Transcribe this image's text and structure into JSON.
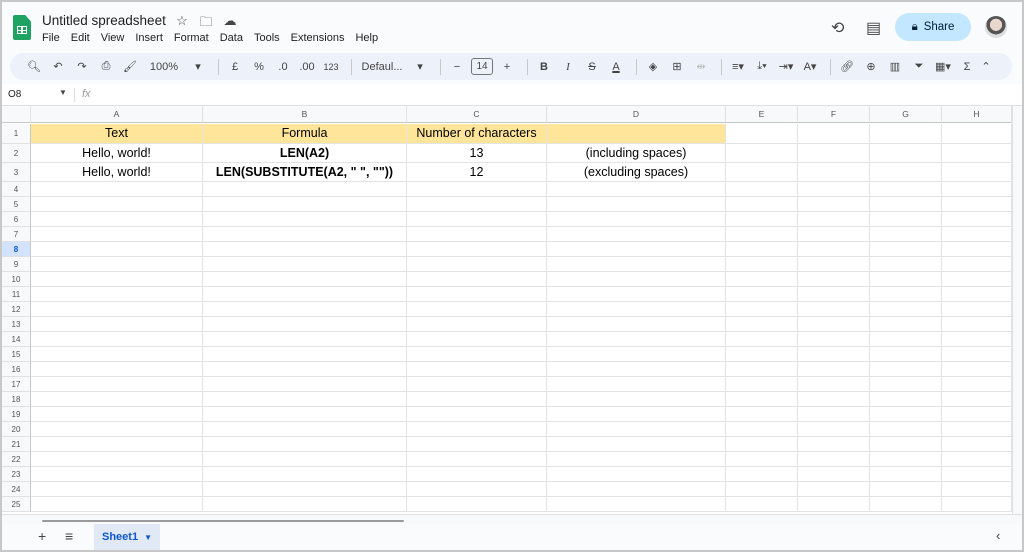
{
  "app": {
    "title": "Untitled spreadsheet",
    "accent": "#1ea362"
  },
  "title_icons": [
    "star-icon",
    "move-to-folder-icon",
    "cloud-saved-icon"
  ],
  "menu": [
    "File",
    "Edit",
    "View",
    "Insert",
    "Format",
    "Data",
    "Tools",
    "Extensions",
    "Help"
  ],
  "header": {
    "share_label": "Share"
  },
  "toolbar": {
    "zoom": "100%",
    "currency": "£",
    "percent": "%",
    "dec_decrease": ".0",
    "dec_increase": ".00",
    "number_format": "123",
    "font": "Defaul...",
    "font_size": "14",
    "minus": "−",
    "plus": "+",
    "bold": "B",
    "italic": "I",
    "sum": "Σ"
  },
  "formula_bar": {
    "cell_ref": "O8",
    "fx": "fx",
    "value": ""
  },
  "columns": [
    "A",
    "B",
    "C",
    "D",
    "E",
    "F",
    "G",
    "H"
  ],
  "rows": [
    "1",
    "2",
    "3",
    "4",
    "5",
    "6",
    "7",
    "8",
    "9",
    "10",
    "11",
    "12",
    "13",
    "14",
    "15",
    "16",
    "17",
    "18",
    "19",
    "20",
    "21",
    "22",
    "23",
    "24",
    "25"
  ],
  "selected_row": "8",
  "cells": {
    "A1": "Text",
    "B1": "Formula",
    "C1": "Number of characters",
    "D1": "",
    "A2": "Hello, world!",
    "B2": "LEN(A2)",
    "C2": "13",
    "D2": "(including spaces)",
    "A3": "Hello, world!",
    "B3": "LEN(SUBSTITUTE(A2, \" \", \"\"))",
    "C3": "12",
    "D3": "(excluding spaces)"
  },
  "header_fill": "#ffe599",
  "sheets": [
    {
      "name": "Sheet1",
      "active": true
    }
  ]
}
